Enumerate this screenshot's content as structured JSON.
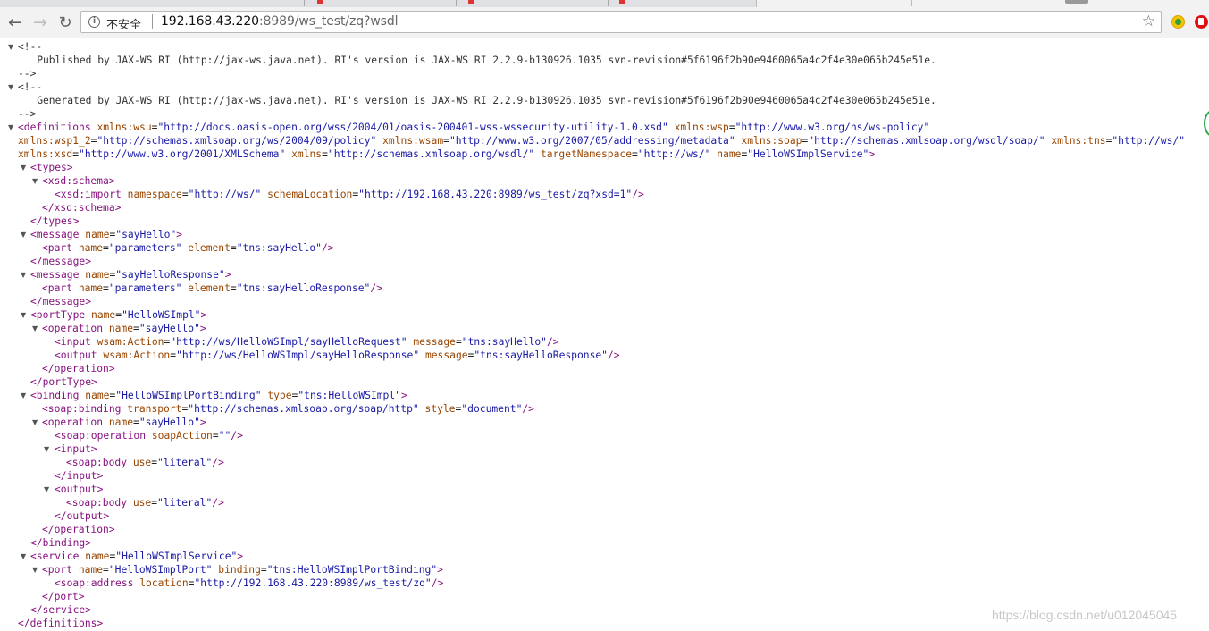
{
  "browser": {
    "security_label": "不安全",
    "url_host": "192.168.43.220",
    "url_rest": ":8989/ws_test/zq?wsdl"
  },
  "icons": [
    "back-icon",
    "forward-icon",
    "reload-icon",
    "info-icon",
    "star-icon",
    "extension-icon",
    "extension-red-icon"
  ],
  "xml": {
    "comment_open": "<!--",
    "comment_close": "-->",
    "published": "    Published by JAX-WS RI (http://jax-ws.java.net). RI's version is JAX-WS RI 2.2.9-b130926.1035 svn-revision#5f6196f2b90e9460065a4c2f4e30e065b245e51e.",
    "generated": "    Generated by JAX-WS RI (http://jax-ws.java.net). RI's version is JAX-WS RI 2.2.9-b130926.1035 svn-revision#5f6196f2b90e9460065a4c2f4e30e065b245e51e."
  },
  "watermark": "https://blog.csdn.net/u012045045"
}
